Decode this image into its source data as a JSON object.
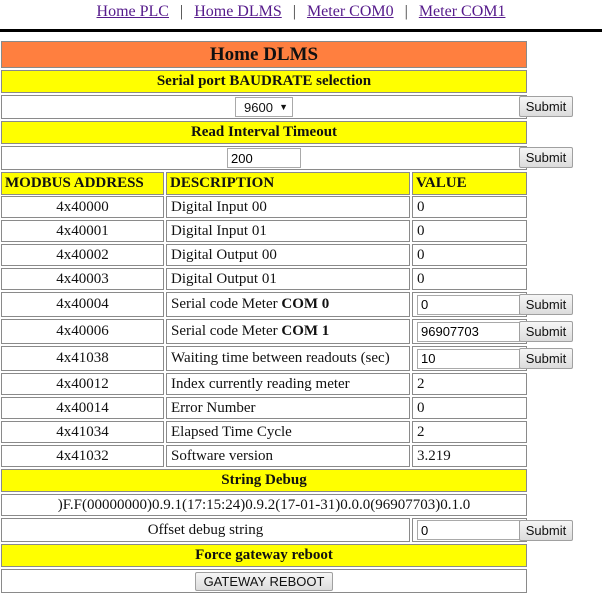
{
  "nav": {
    "links": [
      "Home PLC",
      "Home DLMS",
      "Meter COM0",
      "Meter COM1"
    ],
    "separator": "|"
  },
  "title": "Home DLMS",
  "colors": {
    "title_bg": "#ff7f3f",
    "header_bg": "#ffff00"
  },
  "baud": {
    "header": "Serial port BAUDRATE selection",
    "selected": "9600",
    "submit": "Submit"
  },
  "timeout": {
    "header": "Read Interval Timeout",
    "value": "200",
    "submit": "Submit"
  },
  "table": {
    "headers": [
      "MODBUS ADDRESS",
      "DESCRIPTION",
      "VALUE"
    ],
    "rows": [
      {
        "address": "4x40000",
        "description": "Digital Input 00",
        "value": "0"
      },
      {
        "address": "4x40001",
        "description": "Digital Input 01",
        "value": "0"
      },
      {
        "address": "4x40002",
        "description": "Digital Output 00",
        "value": "0"
      },
      {
        "address": "4x40003",
        "description": "Digital Output 01",
        "value": "0"
      },
      {
        "address": "4x40004",
        "description": "Serial code Meter ",
        "description_bold": "COM 0",
        "value": "0",
        "submit": "Submit"
      },
      {
        "address": "4x40006",
        "description": "Serial code Meter ",
        "description_bold": "COM 1",
        "value": "96907703",
        "submit": "Submit"
      },
      {
        "address": "4x41038",
        "description": "Waiting time between readouts (sec)",
        "value": "10",
        "submit": "Submit"
      },
      {
        "address": "4x40012",
        "description": "Index currently reading meter",
        "value": "2"
      },
      {
        "address": "4x40014",
        "description": "Error Number",
        "value": "0"
      },
      {
        "address": "4x41034",
        "description": "Elapsed Time Cycle",
        "value": "2"
      },
      {
        "address": "4x41032",
        "description": "Software version",
        "value": "3.219"
      }
    ]
  },
  "debug": {
    "header": "String Debug",
    "string": ")F.F(00000000)0.9.1(17:15:24)0.9.2(17-01-31)0.0.0(96907703)0.1.0",
    "offset_label": "Offset debug string",
    "offset_value": "0",
    "submit": "Submit"
  },
  "reboot": {
    "header": "Force gateway reboot",
    "button": "GATEWAY REBOOT"
  }
}
